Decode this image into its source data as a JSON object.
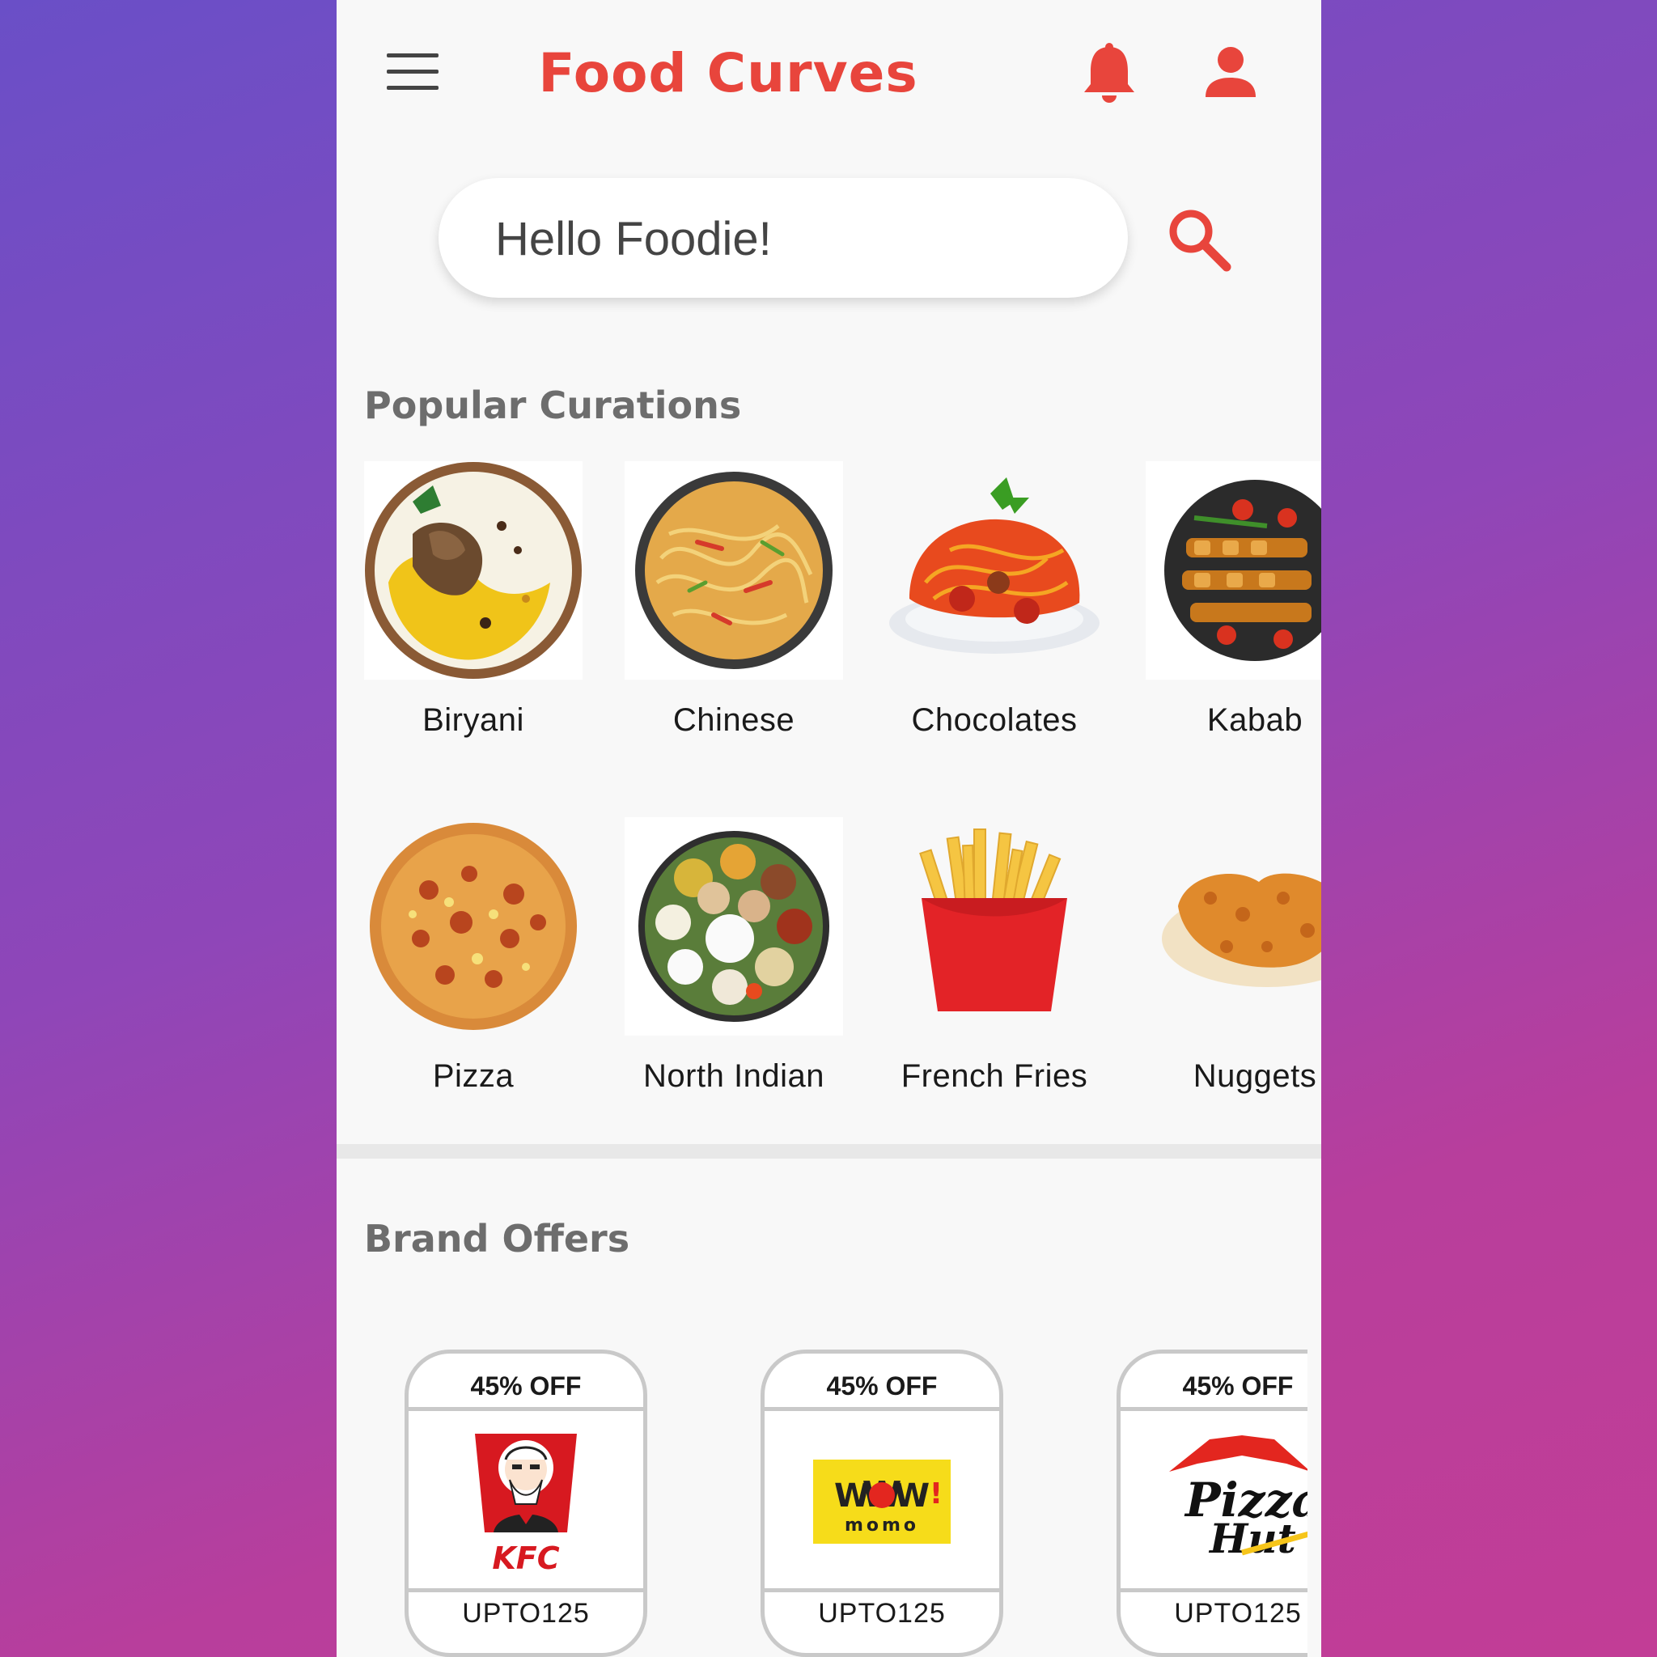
{
  "app": {
    "title": "Food Curves"
  },
  "search": {
    "placeholder": "Hello Foodie!"
  },
  "icons": {
    "menu": "hamburger-menu-icon",
    "notification": "bell-icon",
    "profile": "user-icon",
    "search": "search-icon"
  },
  "colors": {
    "brand": "#e8453c",
    "section_title": "#6d6d6d",
    "phone_background": "#f8f8f8"
  },
  "popular": {
    "title": "Popular Curations",
    "items": [
      {
        "label": "Biryani"
      },
      {
        "label": "Chinese"
      },
      {
        "label": "Chocolates"
      },
      {
        "label": "Kabab"
      },
      {
        "label": "Pizza"
      },
      {
        "label": "North Indian"
      },
      {
        "label": "French Fries"
      },
      {
        "label": "Nuggets"
      }
    ]
  },
  "brand_offers": {
    "title": "Brand Offers",
    "items": [
      {
        "discount": "45% OFF",
        "brand": "KFC",
        "code": "UPTO125"
      },
      {
        "discount": "45% OFF",
        "brand": "WOW! momo",
        "code": "UPTO125"
      },
      {
        "discount": "45% OFF",
        "brand": "Pizza Hut",
        "code": "UPTO125"
      }
    ]
  }
}
